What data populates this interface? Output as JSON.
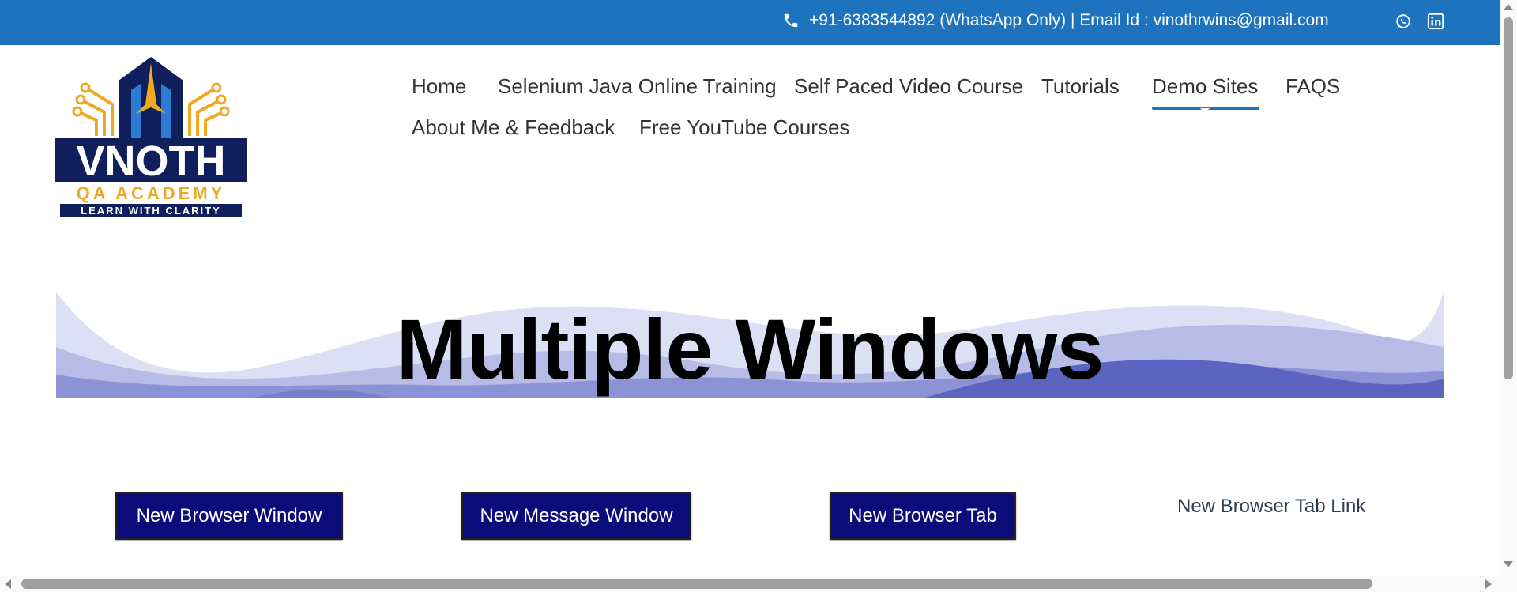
{
  "topbar": {
    "contact_text": "+91-6383544892 (WhatsApp Only) | Email Id : vinothrwins@gmail.com",
    "phone_icon": "phone-icon",
    "social_icons": [
      "whatsapp-icon",
      "linkedin-icon"
    ],
    "background_color": "#1e73be"
  },
  "logo": {
    "brand": "VNOTH",
    "academy": "QA ACADEMY",
    "tagline": "LEARN WITH CLARITY"
  },
  "nav": {
    "items": [
      {
        "label": "Home"
      },
      {
        "label": "Selenium Java Online Training"
      },
      {
        "label": "Self Paced Video Course"
      },
      {
        "label": "Tutorials"
      },
      {
        "label": "Demo Sites",
        "active": true
      },
      {
        "label": "FAQS"
      },
      {
        "label": "About Me & Feedback"
      },
      {
        "label": "Free YouTube Courses"
      }
    ]
  },
  "banner": {
    "title": "Multiple Windows"
  },
  "actions": {
    "new_browser_window": "New Browser Window",
    "new_message_window": "New Message Window",
    "new_browser_tab": "New Browser Tab",
    "new_browser_tab_link": "New Browser Tab Link",
    "button_color": "#0b0b7a"
  }
}
